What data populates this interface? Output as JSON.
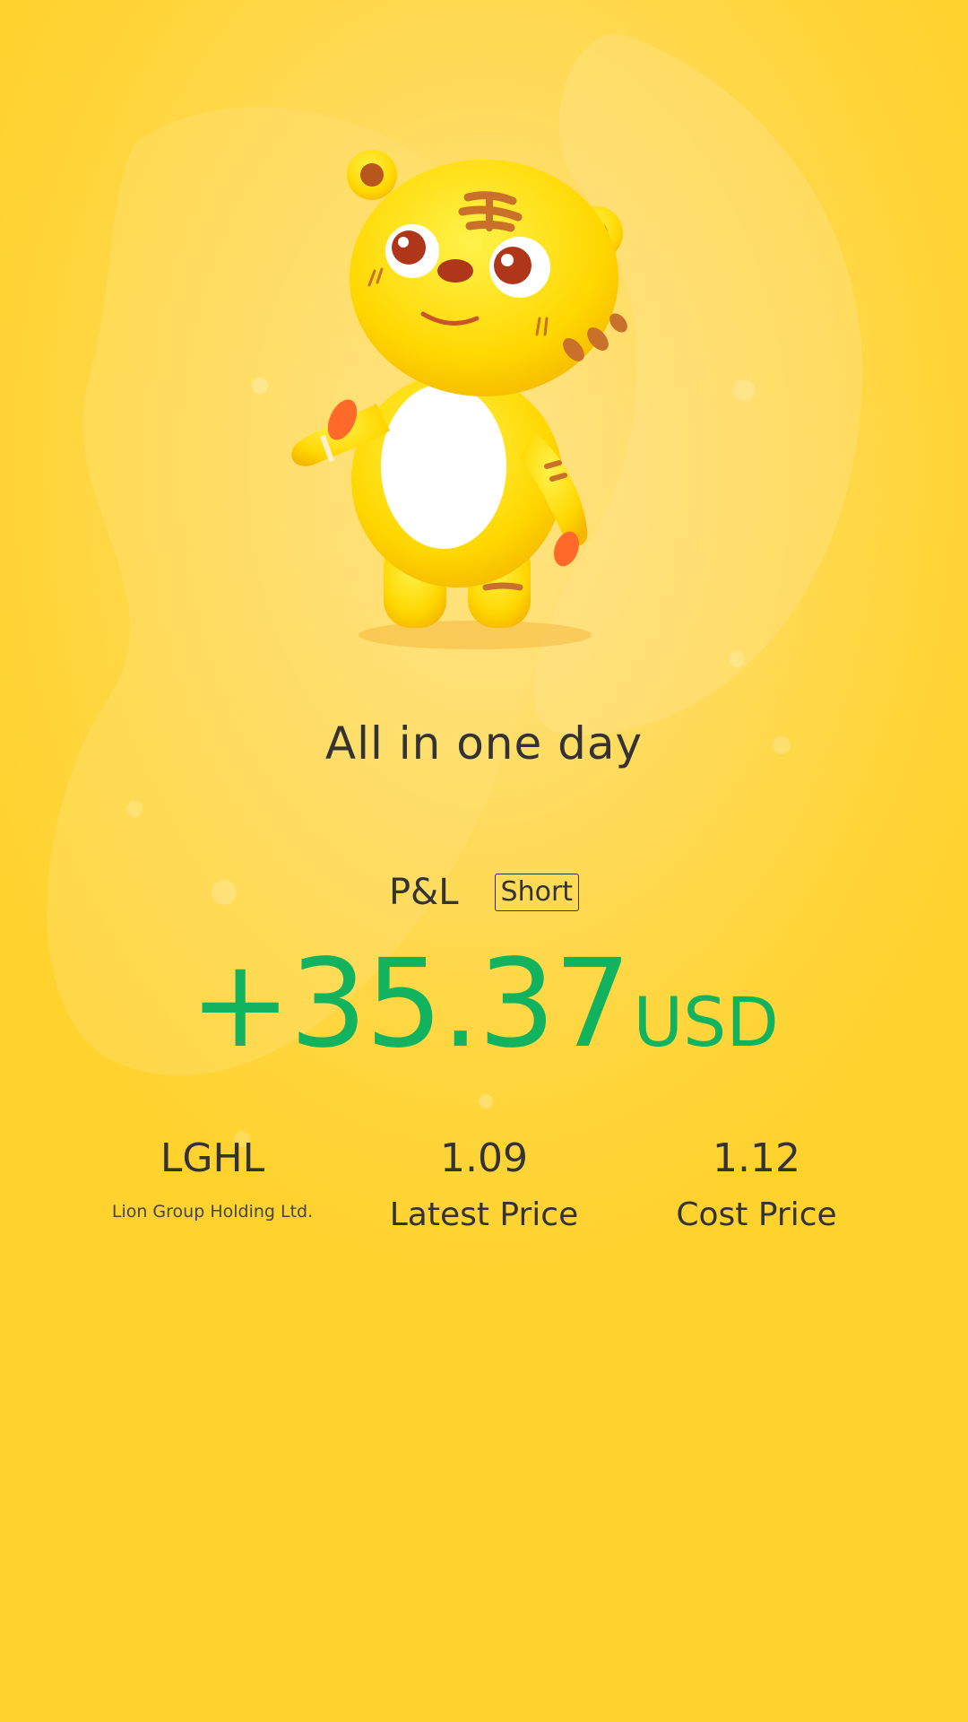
{
  "title": "All in one day",
  "pnl": {
    "label": "P&L",
    "side": "Short",
    "value": "+35.37",
    "unit": "USD"
  },
  "stock": {
    "ticker": "LGHL",
    "name": "Lion Group Holding Ltd."
  },
  "latest": {
    "value": "1.09",
    "label": "Latest Price"
  },
  "cost": {
    "value": "1.12",
    "label": "Cost Price"
  },
  "colors": {
    "background": "#ffd63e",
    "profit": "#12b35f",
    "text": "#333333"
  },
  "icons": {
    "mascot": "tiger-mascot-icon"
  }
}
